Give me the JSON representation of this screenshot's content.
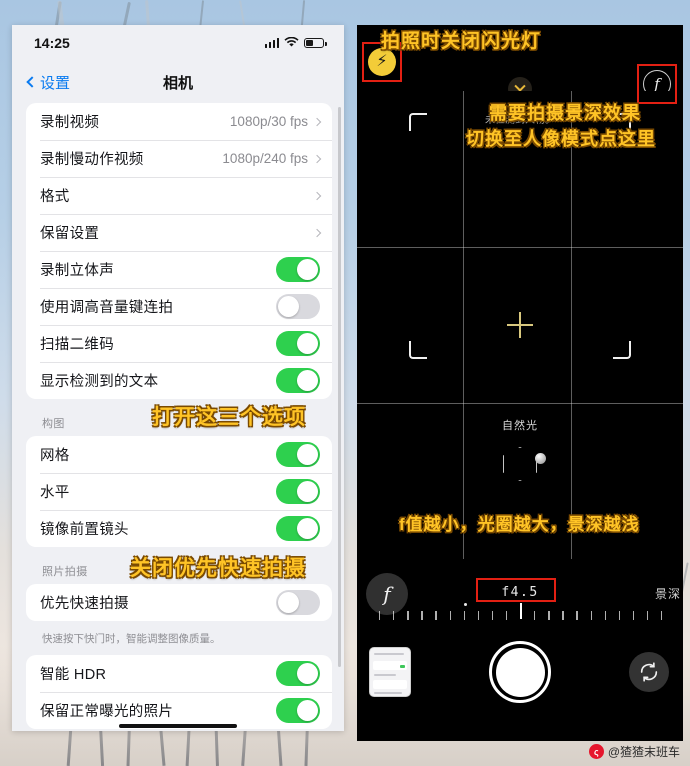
{
  "settings": {
    "status": {
      "time": "14:25",
      "signal_icon": "cellular-signal-icon",
      "wifi_icon": "wifi-icon",
      "battery_icon": "battery-icon"
    },
    "nav": {
      "back_label": "设置",
      "title": "相机"
    },
    "groups": [
      {
        "rows": [
          {
            "label": "录制视频",
            "value": "1080p/30 fps",
            "type": "disclosure"
          },
          {
            "label": "录制慢动作视频",
            "value": "1080p/240 fps",
            "type": "disclosure"
          },
          {
            "label": "格式",
            "value": "",
            "type": "disclosure"
          },
          {
            "label": "保留设置",
            "value": "",
            "type": "disclosure"
          },
          {
            "label": "录制立体声",
            "value": "",
            "type": "toggle",
            "on": true
          },
          {
            "label": "使用调高音量键连拍",
            "value": "",
            "type": "toggle",
            "on": false
          },
          {
            "label": "扫描二维码",
            "value": "",
            "type": "toggle",
            "on": true
          },
          {
            "label": "显示检测到的文本",
            "value": "",
            "type": "toggle",
            "on": true
          }
        ]
      },
      {
        "header": "构图",
        "rows": [
          {
            "label": "网格",
            "value": "",
            "type": "toggle",
            "on": true
          },
          {
            "label": "水平",
            "value": "",
            "type": "toggle",
            "on": true
          },
          {
            "label": "镜像前置镜头",
            "value": "",
            "type": "toggle",
            "on": true
          }
        ]
      },
      {
        "header": "照片拍摄",
        "footer": "快速按下快门时，智能调整图像质量。",
        "rows": [
          {
            "label": "优先快速拍摄",
            "value": "",
            "type": "toggle",
            "on": false
          }
        ]
      },
      {
        "rows": [
          {
            "label": "智能 HDR",
            "value": "",
            "type": "toggle",
            "on": true
          },
          {
            "label": "保留正常曝光的照片",
            "value": "",
            "type": "toggle",
            "on": true
          }
        ]
      }
    ],
    "annotations": {
      "toggles_three": "打开这三个选项",
      "disable_fast_capture": "关闭优先快速拍摄"
    }
  },
  "camera": {
    "top": {
      "flash_icon": "flash-icon",
      "chevron_icon": "chevron-down-icon",
      "aperture_icon": "f-stop-icon"
    },
    "viewfinder": {
      "hint": "未检测到人物。",
      "light_effect": "自然光"
    },
    "aperture": {
      "f_button_label": "f",
      "value": "f4.5",
      "mode_label": "景深"
    },
    "bottom": {
      "thumbnail_name": "last-photo-thumbnail",
      "shutter_name": "shutter-button",
      "flip_icon": "camera-flip-icon"
    },
    "annotations": {
      "flash_off": "拍照时关闭闪光灯",
      "portrait_line1": "需要拍摄景深效果",
      "portrait_line2": "切换至人像模式点这里",
      "aperture_tip": "f值越小，光圈越大，景深越浅"
    }
  },
  "watermark": {
    "logo": "weibo-logo",
    "handle": "@猹猹末班车"
  },
  "colors": {
    "accent_blue": "#0a7bf0",
    "toggle_on": "#2ed04e",
    "annotation": "#ffc426",
    "highlight_box": "#e32013"
  }
}
